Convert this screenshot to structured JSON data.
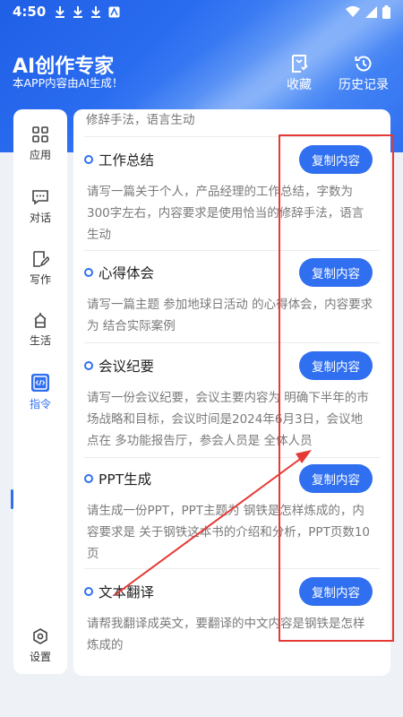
{
  "status": {
    "time": "4:50"
  },
  "header": {
    "title": "AI创作专家",
    "subtitle": "本APP内容由AI生成！",
    "favorites_label": "收藏",
    "history_label": "历史记录"
  },
  "sidebar": {
    "items": [
      {
        "label": "应用",
        "icon": "grid-icon"
      },
      {
        "label": "对话",
        "icon": "chat-icon"
      },
      {
        "label": "写作",
        "icon": "edit-icon"
      },
      {
        "label": "生活",
        "icon": "house-icon"
      },
      {
        "label": "指令",
        "icon": "code-icon",
        "active": true
      },
      {
        "label": "设置",
        "icon": "settings-icon"
      }
    ]
  },
  "content": {
    "clipped_text": "修辞手法，语言生动",
    "cards": [
      {
        "title": "工作总结",
        "button": "复制内容",
        "desc": "请写一篇关于个人，产品经理的工作总结，字数为300字左右，内容要求是使用恰当的修辞手法，语言生动"
      },
      {
        "title": "心得体会",
        "button": "复制内容",
        "desc": "请写一篇主题 参加地球日活动 的心得体会，内容要求为 结合实际案例"
      },
      {
        "title": "会议纪要",
        "button": "复制内容",
        "desc": "请写一份会议纪要，会议主要内容为 明确下半年的市场战略和目标，会议时间是2024年6月3日，会议地点在 多功能报告厅，参会人员是 全体人员"
      },
      {
        "title": "PPT生成",
        "button": "复制内容",
        "desc": "请生成一份PPT，PPT主题为 钢铁是怎样炼成的，内容要求是 关于钢铁这本书的介绍和分析，PPT页数10页"
      },
      {
        "title": "文本翻译",
        "button": "复制内容",
        "desc": "请帮我翻译成英文，要翻译的中文内容是钢铁是怎样炼成的"
      }
    ]
  },
  "colors": {
    "accent": "#2f6ff0",
    "annotation": "#e53935"
  }
}
